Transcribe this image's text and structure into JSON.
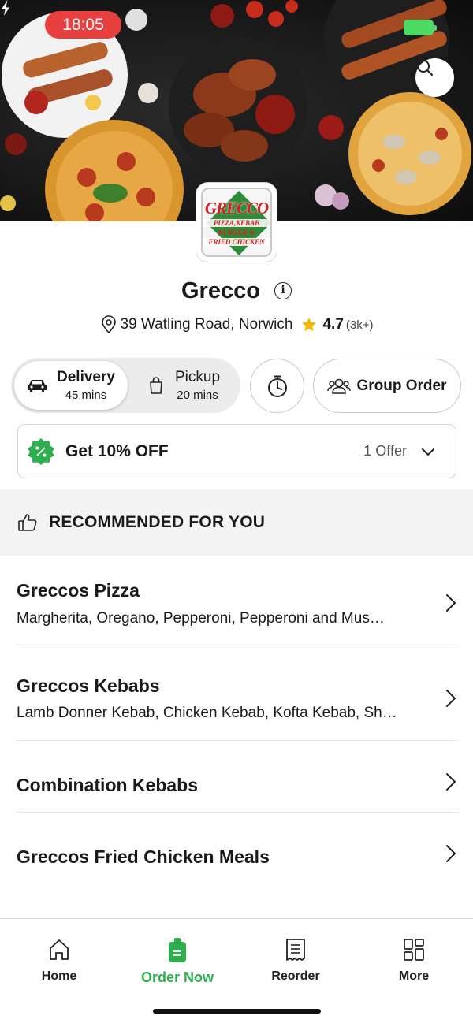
{
  "status_bar": {
    "time": "18:05"
  },
  "header": {
    "search_icon": "search-icon"
  },
  "logo": {
    "line1": "GRECCO",
    "line2": "PIZZA,KEBAB",
    "line3": "BURGER &",
    "line4": "FRIED CHICKEN"
  },
  "restaurant": {
    "name": "Grecco",
    "address": "39 Watling Road, Norwich",
    "rating": "4.7",
    "rating_count": "(3k+)"
  },
  "order_mode": {
    "delivery": {
      "label": "Delivery",
      "time": "45 mins",
      "selected": true
    },
    "pickup": {
      "label": "Pickup",
      "time": "20 mins",
      "selected": false
    }
  },
  "group_order": {
    "label": "Group Order"
  },
  "offer": {
    "title": "Get 10% OFF",
    "count": "1 Offer"
  },
  "recommended": {
    "title": "RECOMMENDED FOR YOU"
  },
  "categories": [
    {
      "title": "Greccos Pizza",
      "subtitle": "Margherita, Oregano, Pepperoni, Pepperoni and Mus…"
    },
    {
      "title": "Greccos Kebabs",
      "subtitle": "Lamb Donner Kebab, Chicken Kebab, Kofta Kebab, Sh…"
    },
    {
      "title": "Combination Kebabs",
      "subtitle": ""
    },
    {
      "title": "Greccos Fried Chicken Meals",
      "subtitle": ""
    }
  ],
  "tabs": [
    {
      "label": "Home",
      "icon": "home-icon"
    },
    {
      "label": "Order Now",
      "icon": "order-bag-icon",
      "active": true
    },
    {
      "label": "Reorder",
      "icon": "receipt-icon"
    },
    {
      "label": "More",
      "icon": "grid-icon"
    }
  ],
  "colors": {
    "accent": "#2fae4f",
    "status_pill": "#e8403f",
    "star": "#f5b800"
  }
}
